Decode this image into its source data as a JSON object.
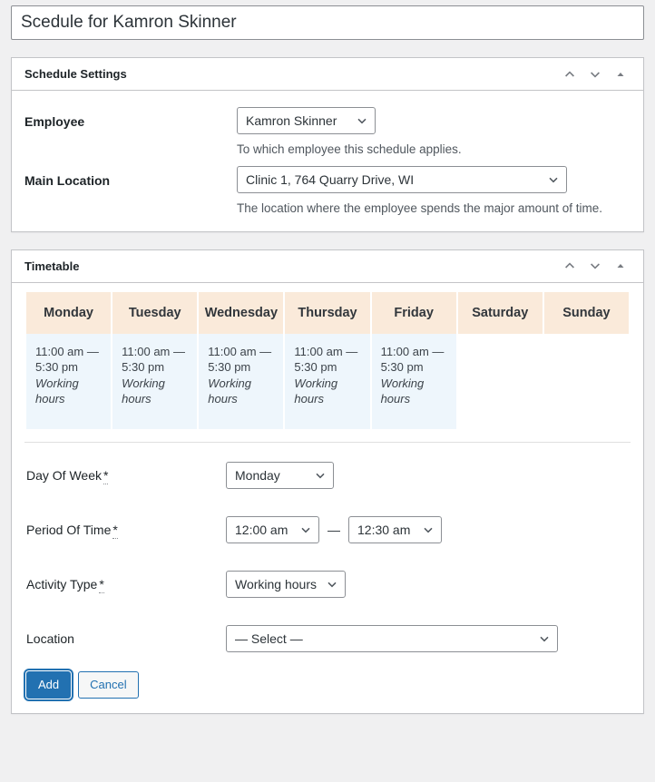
{
  "title": {
    "value": "Scedule for Kamron Skinner"
  },
  "panels": {
    "settings": {
      "heading": "Schedule Settings",
      "actions": {
        "move_up": "move-up",
        "move_down": "move-down",
        "toggle": "toggle-panel"
      },
      "fields": {
        "employee": {
          "label": "Employee",
          "value": "Kamron Skinner",
          "help": "To which employee this schedule applies."
        },
        "main_location": {
          "label": "Main Location",
          "value": "Clinic 1, 764 Quarry Drive, WI",
          "help": "The location where the employee spends the major amount of time."
        }
      }
    },
    "timetable": {
      "heading": "Timetable",
      "actions": {
        "move_up": "move-up",
        "move_down": "move-down",
        "toggle": "toggle-panel"
      },
      "table": {
        "columns": [
          "Monday",
          "Tuesday",
          "Wednesday",
          "Thursday",
          "Friday",
          "Saturday",
          "Sunday"
        ],
        "cells": [
          {
            "time": "11:00 am — 5:30 pm",
            "activity": "Working hours"
          },
          {
            "time": "11:00 am — 5:30 pm",
            "activity": "Working hours"
          },
          {
            "time": "11:00 am — 5:30 pm",
            "activity": "Working hours"
          },
          {
            "time": "11:00 am — 5:30 pm",
            "activity": "Working hours"
          },
          {
            "time": "11:00 am — 5:30 pm",
            "activity": "Working hours"
          },
          {
            "time": "",
            "activity": ""
          },
          {
            "time": "",
            "activity": ""
          }
        ]
      },
      "entry_form": {
        "day_of_week": {
          "label": "Day Of Week",
          "required_mark": "*",
          "value": "Monday"
        },
        "period_of_time": {
          "label": "Period Of Time",
          "required_mark": "*",
          "from_value": "12:00 am",
          "separator": "—",
          "to_value": "12:30 am"
        },
        "activity_type": {
          "label": "Activity Type",
          "required_mark": "*",
          "value": "Working hours"
        },
        "location": {
          "label": "Location",
          "value": "— Select —"
        },
        "buttons": {
          "add": "Add",
          "cancel": "Cancel"
        }
      }
    }
  },
  "colors": {
    "page_background": "#f0f0f1",
    "panel_border": "#c3c4c7",
    "header_cell": "#faeada",
    "busy_cell": "#eef6fc",
    "primary": "#2271b1",
    "text": "#1d2327"
  }
}
